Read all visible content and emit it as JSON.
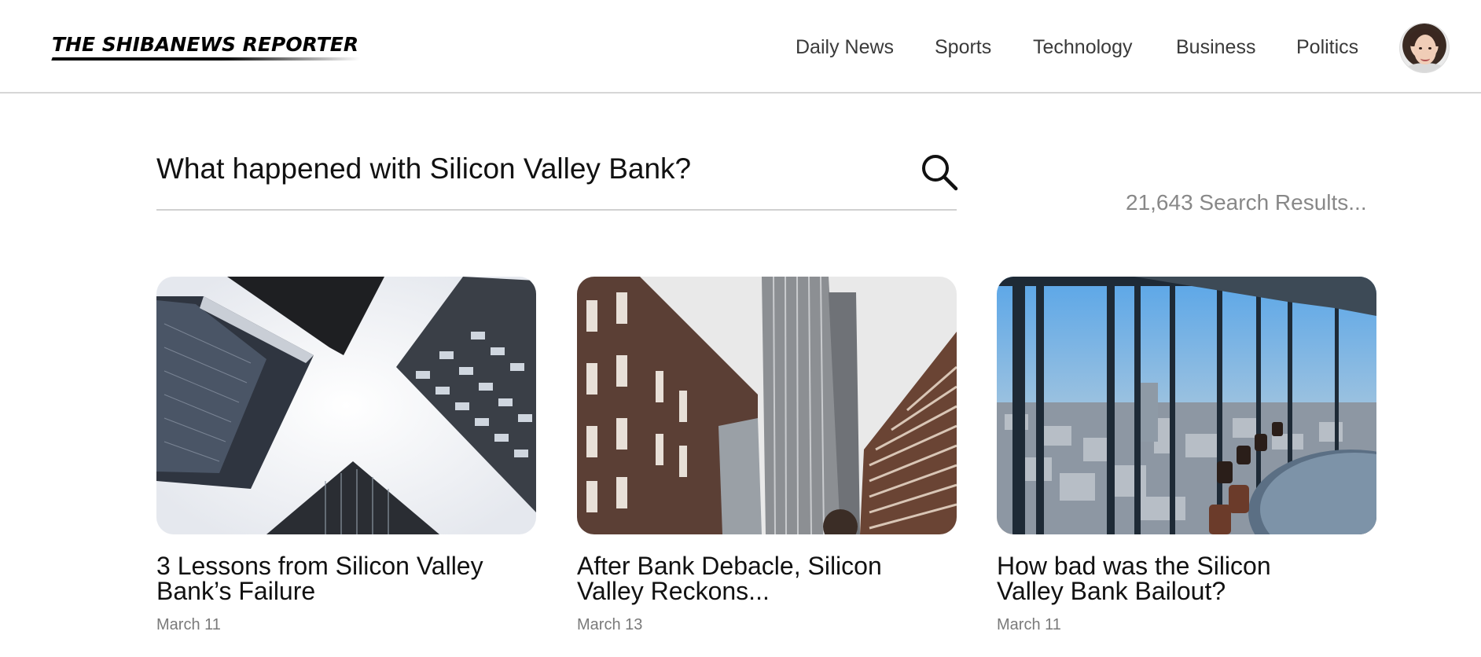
{
  "header": {
    "logo": "THE SHIBANEWS REPORTER",
    "nav": [
      {
        "label": "Daily News"
      },
      {
        "label": "Sports"
      },
      {
        "label": "Technology"
      },
      {
        "label": "Business"
      },
      {
        "label": "Politics"
      }
    ]
  },
  "search": {
    "query": "What happened with Silicon Valley Bank?",
    "results_count": "21,643 Search Results..."
  },
  "articles": [
    {
      "title": "3 Lessons from Silicon Valley Bank’s Failure",
      "date": "March 11"
    },
    {
      "title": "After Bank Debacle, Silicon Valley Reckons...",
      "date": "March 13"
    },
    {
      "title": "How bad was the Silicon Valley Bank Bailout?",
      "date": "March 11"
    }
  ]
}
